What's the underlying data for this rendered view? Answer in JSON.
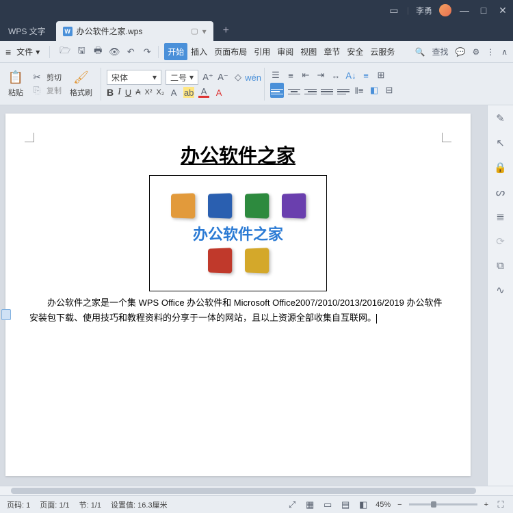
{
  "titlebar": {
    "minimize": "—",
    "maximize": "□",
    "close": "✕"
  },
  "user": {
    "name": "李勇"
  },
  "tabs": {
    "app_label": "WPS 文字",
    "doc_label": "办公软件之家.wps",
    "doc_icon_letter": "W",
    "add": "+",
    "presenter": "▢"
  },
  "menubar": {
    "file": "文件",
    "file_arrow": "▾",
    "items": [
      "开始",
      "插入",
      "页面布局",
      "引用",
      "审阅",
      "视图",
      "章节",
      "安全",
      "云服务"
    ],
    "active_index": 0,
    "search_label": "查找",
    "collapse": "∧"
  },
  "ribbon": {
    "paste": "粘贴",
    "cut": "剪切",
    "copy": "复制",
    "format_painter": "格式刷",
    "font_name": "宋体",
    "font_size": "二号",
    "bold": "B",
    "italic": "I",
    "underline": "U",
    "strike": "A",
    "sup": "X²",
    "sub": "X₂"
  },
  "document": {
    "title": "办公软件之家",
    "logo_text": "办公软件之家",
    "body": "办公软件之家是一个集 WPS Office 办公软件和 Microsoft Office2007/2010/2013/2016/2019 办公软件安装包下载、使用技巧和教程资料的分享于一体的网站，且以上资源全部收集自互联网。"
  },
  "statusbar": {
    "page_code": "页码: 1",
    "page": "页面: 1/1",
    "section": "节: 1/1",
    "position": "设置值: 16.3厘米",
    "zoom": "45%"
  }
}
